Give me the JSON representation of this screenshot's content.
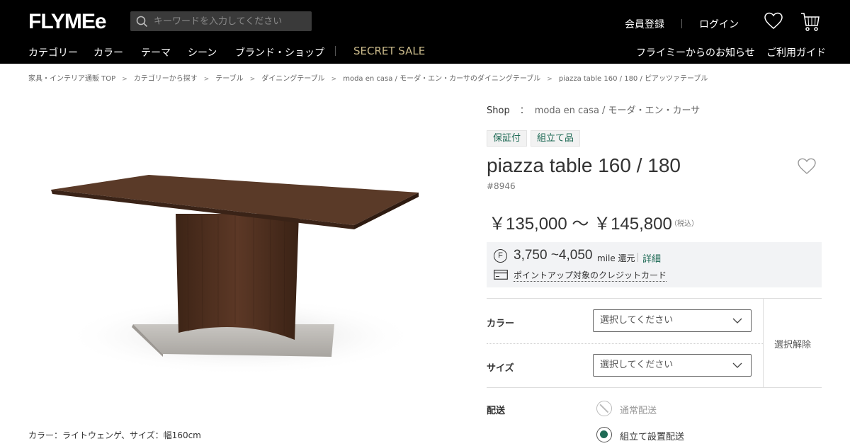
{
  "header": {
    "logo": "FLYMEe",
    "search_placeholder": "キーワードを入力してください",
    "register": "会員登録",
    "login": "ログイン",
    "nav": [
      "カテゴリー",
      "カラー",
      "テーマ",
      "シーン",
      "ブランド・ショップ"
    ],
    "secret_sale": "SECRET SALE",
    "news": "フライミーからのお知らせ",
    "guide": "ご利用ガイド"
  },
  "breadcrumb": [
    "家具・インテリア通販 TOP",
    "カテゴリーから探す",
    "テーブル",
    "ダイニングテーブル",
    "moda en casa / モーダ・エン・カーサのダイニングテーブル",
    "piazza table 160 / 180 / ピアッツァテーブル"
  ],
  "product": {
    "shop_label": "Shop",
    "shop_colon": "：",
    "shop_name": "moda en casa / モーダ・エン・カーサ",
    "tags": [
      "保証付",
      "組立て品"
    ],
    "title": "piazza table 160 / 180",
    "sku": "#8946",
    "price": "￥135,000 ～ ￥145,800",
    "tax_note": "（税込）",
    "image_caption": "カラー：ライトウェンゲ、サイズ：幅160cm"
  },
  "mile": {
    "coin": "F",
    "range": "3,750 ~4,050",
    "unit": "mile 還元",
    "detail": "詳細",
    "card_link": "ポイントアップ対象のクレジットカード"
  },
  "options": {
    "color_label": "カラー",
    "color_value": "選択してください",
    "size_label": "サイズ",
    "size_value": "選択してください",
    "clear": "選択解除"
  },
  "shipping": {
    "label": "配送",
    "normal": "通常配送",
    "assembly": "組立て設置配送",
    "normal_available": false,
    "selected": "組立て設置配送"
  },
  "colors": {
    "header_bg": "#000000",
    "accent_green": "#1e6a55",
    "sale_gold": "#c9b98a"
  }
}
